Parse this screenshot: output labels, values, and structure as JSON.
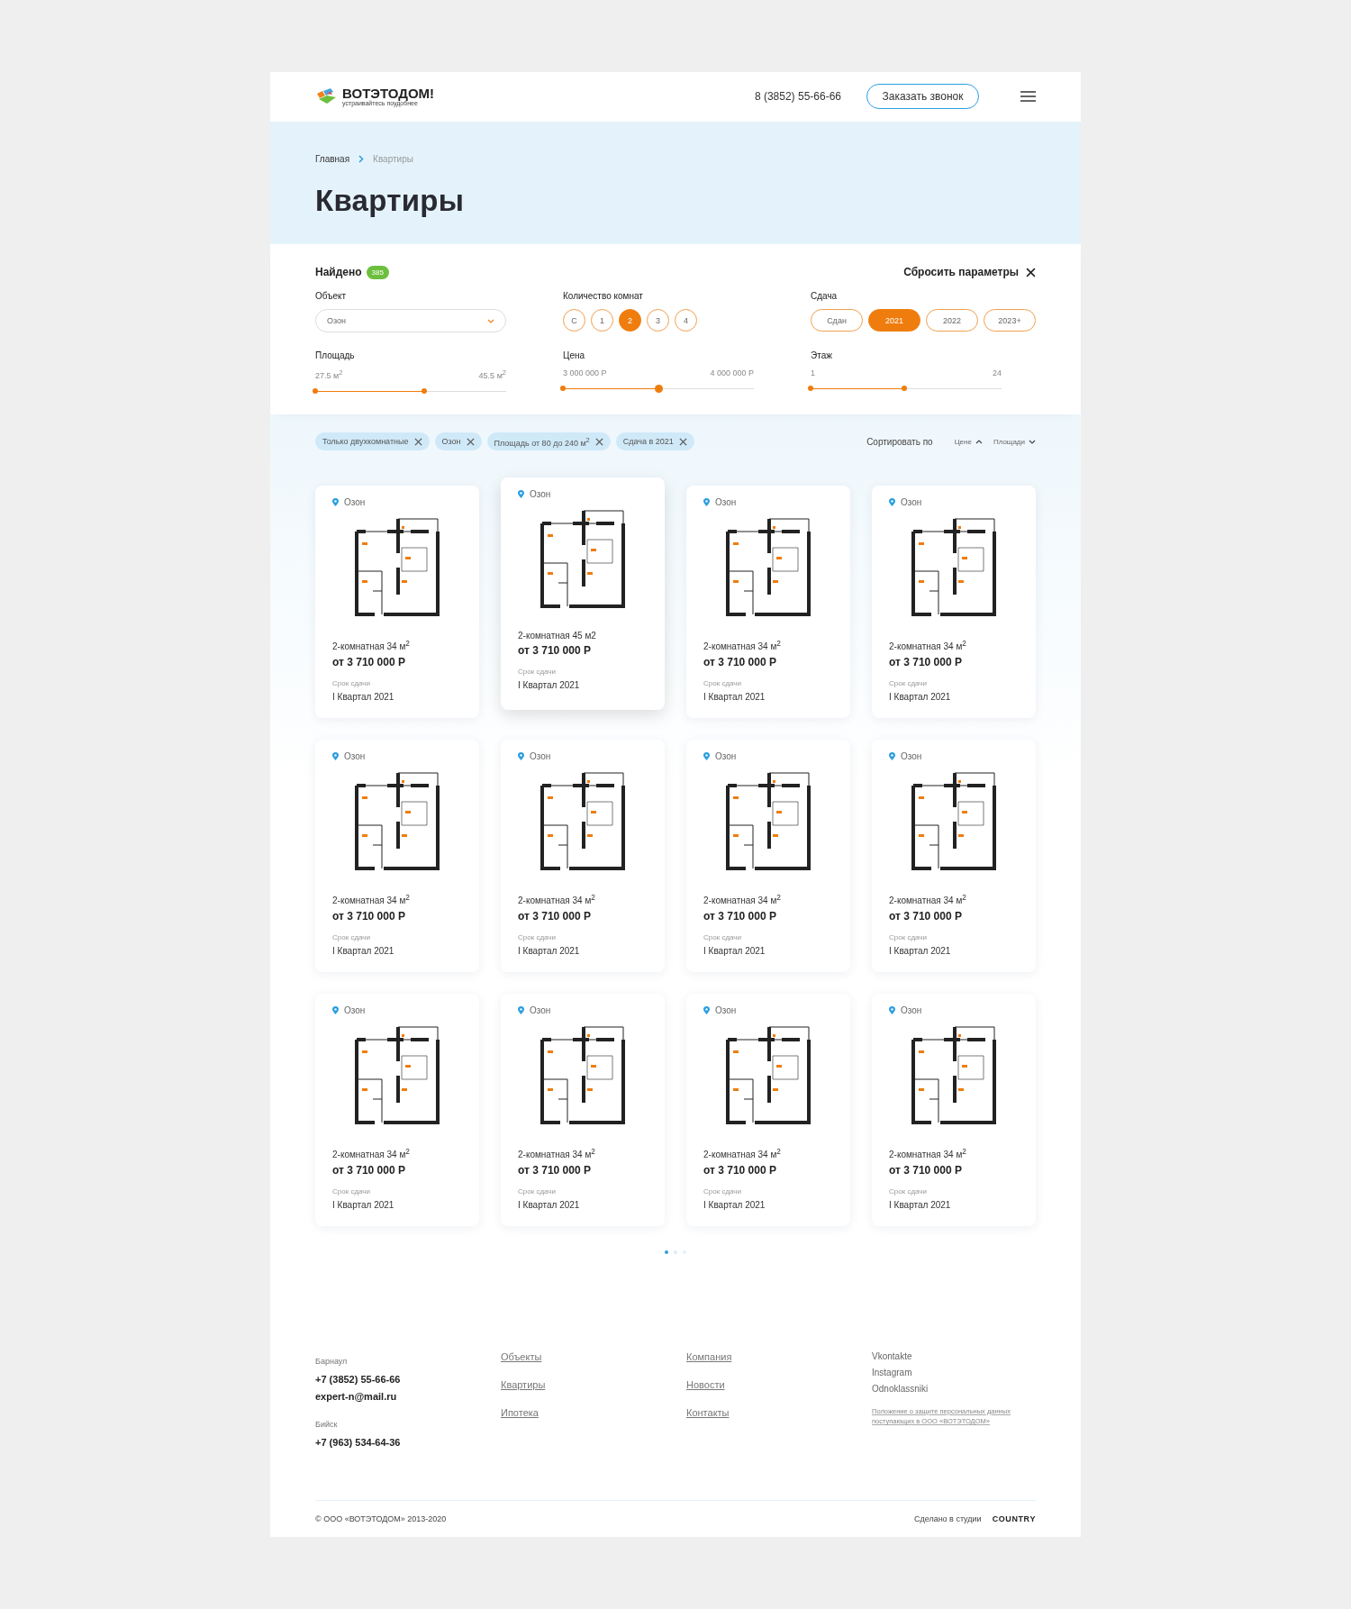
{
  "header": {
    "logo_name": "ВОТЭТОДОМ!",
    "logo_tagline": "устраивайтесь поудобнее",
    "phone": "8 (3852) 55-66-66",
    "call_button": "Заказать звонок"
  },
  "breadcrumbs": [
    {
      "label": "Главная",
      "current": false
    },
    {
      "label": "Квартиры",
      "current": true
    }
  ],
  "page_title": "Квартиры",
  "filters": {
    "found_label": "Найдено",
    "found_count": "385",
    "reset": "Сбросить параметры",
    "object": {
      "label": "Объект",
      "value": "Озон"
    },
    "rooms": {
      "label": "Количество комнат",
      "options": [
        {
          "label": "С",
          "selected": false
        },
        {
          "label": "1",
          "selected": false
        },
        {
          "label": "2",
          "selected": true
        },
        {
          "label": "3",
          "selected": false
        },
        {
          "label": "4",
          "selected": false
        }
      ]
    },
    "delivery": {
      "label": "Сдача",
      "options": [
        {
          "label": "Сдан",
          "selected": false
        },
        {
          "label": "2021",
          "selected": true
        },
        {
          "label": "2022",
          "selected": false
        },
        {
          "label": "2023+",
          "selected": false
        }
      ]
    },
    "sliders": [
      {
        "label": "Площадь",
        "min": "27.5 м$^{2}$",
        "max": "45.5 м$^{2}$",
        "level": 0.57,
        "active": false
      },
      {
        "label": "Цена",
        "min": "3 000 000 Р",
        "max": "4 000 000 Р",
        "level": 0.5,
        "active": true
      },
      {
        "label": "Этаж",
        "min": "1",
        "max": "24",
        "level": 0.49,
        "active": false
      }
    ]
  },
  "chips": [
    "Только двухкомнатные",
    "Озон",
    "Площадь от 80 до 240 м$^{2}$",
    "Сдача в 2021"
  ],
  "sort": {
    "label": "Сортировать по",
    "options": [
      {
        "label": "Цене",
        "ascending": true
      },
      {
        "label": "Площади",
        "ascending": false
      }
    ]
  },
  "cards": [
    {
      "place": "Озон",
      "title": "2-комнатная 34 м$^{2}$",
      "price": "от 3 710 000 Р",
      "term_label": "Срок сдачи",
      "term": "I Квартал 2021",
      "hovered": false
    },
    {
      "place": "Озон",
      "title": "2-комнатная 45 м2",
      "price": "от 3 710 000 Р",
      "term_label": "Срок сдачи",
      "term": "I Квартал 2021",
      "hovered": true
    },
    {
      "place": "Озон",
      "title": "2-комнатная 34 м$^{2}$",
      "price": "от 3 710 000 Р",
      "term_label": "Срок сдачи",
      "term": "I Квартал 2021",
      "hovered": false
    },
    {
      "place": "Озон",
      "title": "2-комнатная 34 м$^{2}$",
      "price": "от 3 710 000 Р",
      "term_label": "Срок сдачи",
      "term": "I Квартал 2021",
      "hovered": false
    },
    {
      "place": "Озон",
      "title": "2-комнатная 34 м$^{2}$",
      "price": "от 3 710 000 Р",
      "term_label": "Срок сдачи",
      "term": "I Квартал 2021",
      "hovered": false
    },
    {
      "place": "Озон",
      "title": "2-комнатная 34 м$^{2}$",
      "price": "от 3 710 000 Р",
      "term_label": "Срок сдачи",
      "term": "I Квартал 2021",
      "hovered": false
    },
    {
      "place": "Озон",
      "title": "2-комнатная 34 м$^{2}$",
      "price": "от 3 710 000 Р",
      "term_label": "Срок сдачи",
      "term": "I Квартал 2021",
      "hovered": false
    },
    {
      "place": "Озон",
      "title": "2-комнатная 34 м$^{2}$",
      "price": "от 3 710 000 Р",
      "term_label": "Срок сдачи",
      "term": "I Квартал 2021",
      "hovered": false
    },
    {
      "place": "Озон",
      "title": "2-комнатная 34 м$^{2}$",
      "price": "от 3 710 000 Р",
      "term_label": "Срок сдачи",
      "term": "I Квартал 2021",
      "hovered": false
    },
    {
      "place": "Озон",
      "title": "2-комнатная 34 м$^{2}$",
      "price": "от 3 710 000 Р",
      "term_label": "Срок сдачи",
      "term": "I Квартал 2021",
      "hovered": false
    },
    {
      "place": "Озон",
      "title": "2-комнатная 34 м$^{2}$",
      "price": "от 3 710 000 Р",
      "term_label": "Срок сдачи",
      "term": "I Квартал 2021",
      "hovered": false
    },
    {
      "place": "Озон",
      "title": "2-комнатная 34 м$^{2}$",
      "price": "от 3 710 000 Р",
      "term_label": "Срок сдачи",
      "term": "I Квартал 2021",
      "hovered": false
    }
  ],
  "pagination": [
    {
      "selected": true
    },
    {
      "selected": false
    },
    {
      "selected": false
    }
  ],
  "footer": {
    "contacts": [
      {
        "city": "Барнаул",
        "lines": [
          "+7 (3852) 55-66-66",
          "expert-n@mail.ru"
        ]
      },
      {
        "city": "Бийск",
        "lines": [
          "+7 (963) 534-64-36"
        ]
      }
    ],
    "menu_1": [
      "Объекты",
      "Квартиры",
      "Ипотека"
    ],
    "menu_2": [
      "Компания",
      "Новости",
      "Контакты"
    ],
    "social": [
      "Vkontakte",
      "Instagram",
      "Odnoklassniki"
    ],
    "policy": "Положение о защите персональных данных поступающих в ООО «ВОТЭТОДОМ»",
    "copyright": "© ООО «ВОТЭТОДОМ» 2013-2020",
    "made_by": "Сделано в студии",
    "studio": "COUNTRY"
  }
}
